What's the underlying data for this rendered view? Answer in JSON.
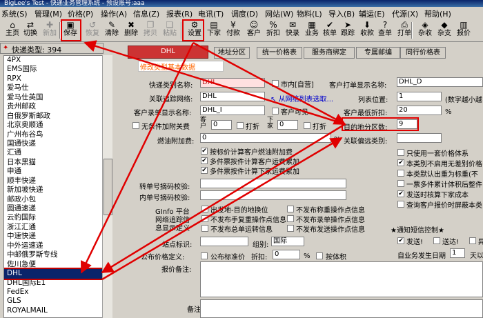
{
  "window": {
    "title": "BigLee's Test - 快递业务管理系统 - 预设账号:aaa"
  },
  "menu": [
    "系统(S)",
    "管理(M)",
    "价格(P)",
    "操作(A)",
    "信息(Z)",
    "报表(R)",
    "电讯(T)",
    "调度(D)",
    "网站(W)",
    "物料(L)",
    "导入(B)",
    "辅运(E)",
    "代源(X)",
    "帮助(H)"
  ],
  "toolbar": {
    "left": [
      {
        "icon": "home-icon",
        "glyph": "⌂",
        "label": "主页",
        "enabled": true
      },
      {
        "icon": "switch-icon",
        "glyph": "⇄",
        "label": "切换",
        "enabled": true
      },
      {
        "icon": "add-icon",
        "glyph": "✚",
        "label": "新加",
        "enabled": false
      },
      {
        "icon": "save-icon",
        "glyph": "▣",
        "label": "保存",
        "enabled": true
      },
      {
        "icon": "recycle-icon",
        "glyph": "↺",
        "label": "恢复",
        "enabled": false
      },
      {
        "icon": "clear-icon",
        "glyph": "✎",
        "label": "清除",
        "enabled": true
      },
      {
        "icon": "delete-icon",
        "glyph": "✖",
        "label": "删除",
        "enabled": true
      },
      {
        "icon": "copy-icon",
        "glyph": "❐",
        "label": "拷贝",
        "enabled": false
      },
      {
        "icon": "paste-icon",
        "glyph": "❏",
        "label": "粘贴",
        "enabled": false
      },
      {
        "icon": "settings-icon",
        "glyph": "⚙",
        "label": "设置",
        "enabled": true
      },
      {
        "icon": "order-icon",
        "glyph": "▤",
        "label": "下家",
        "enabled": true
      },
      {
        "icon": "pay-icon",
        "glyph": "¥",
        "label": "付款",
        "enabled": true
      },
      {
        "icon": "customer-icon",
        "glyph": "☺",
        "label": "客户",
        "enabled": true
      },
      {
        "icon": "discount-icon",
        "glyph": "%",
        "label": "折扣",
        "enabled": true
      },
      {
        "icon": "quick-icon",
        "glyph": "✉",
        "label": "快录",
        "enabled": true
      },
      {
        "icon": "business-icon",
        "glyph": "▦",
        "label": "业务",
        "enabled": true
      },
      {
        "icon": "check-icon",
        "glyph": "✔",
        "label": "核单",
        "enabled": true
      },
      {
        "icon": "track-icon",
        "glyph": "➤",
        "label": "跟踪",
        "enabled": true
      },
      {
        "icon": "receive-icon",
        "glyph": "⬇",
        "label": "收款",
        "enabled": true
      },
      {
        "icon": "query-icon",
        "glyph": "?",
        "label": "查单",
        "enabled": true
      },
      {
        "icon": "print-icon",
        "glyph": "⎙",
        "label": "打单",
        "enabled": true
      },
      {
        "icon": "misc-icon",
        "glyph": "◈",
        "label": "杂收",
        "enabled": true
      },
      {
        "icon": "misc-pay-icon",
        "glyph": "◆",
        "label": "杂支",
        "enabled": true
      },
      {
        "icon": "report-icon",
        "glyph": "▥",
        "label": "报价",
        "enabled": true
      }
    ]
  },
  "left_panel": {
    "header": "快递类型: 394",
    "items": [
      "4PX",
      "EMS国际",
      "RPX",
      "爱马仕",
      "爱马仕英国",
      "贵州邮政",
      "白俄罗斯邮政",
      "北京奥顺通",
      "广州布谷鸟",
      "国通快递",
      "汇通",
      "日本黑猫",
      "申通",
      "顺丰快递",
      "新加坡快递",
      "邮政小包",
      "圆通速递",
      "云豹国际",
      "浙江汇通",
      "中速快递",
      "中外运速递",
      "中邮俄罗斯专线",
      "佐川急便",
      "DHL",
      "DHL国际E1",
      "FedEx",
      "GLS",
      "ROYALMAIL"
    ],
    "selected": "DHL"
  },
  "tabs": [
    "DHL",
    "地址分区",
    "统一价格表",
    "服务商绑定",
    "专属邮编",
    "同行价格表"
  ],
  "form": {
    "modify_link": "修改类型基本数据",
    "type_name_label": "快递类别名称:",
    "type_name": "DHL",
    "local_label": "市内[自营]",
    "print_name_label": "客户打单显示名称:",
    "print_name": "DHL_D",
    "tracking_label": "关联追踪网络:",
    "tracking": "DHL",
    "select_link": "从网络列表选取...",
    "list_pos_label": "列表位置:",
    "list_pos": "1",
    "list_pos_hint": "(数字越小越",
    "cust_display_label": "客户录单显示名称:",
    "cust_display": "DHL_I",
    "cust_visible_label": "客户可见",
    "min_discount_label": "客户最低折扣:",
    "min_discount": "20",
    "percent": "%",
    "unconditional_label": "无条件加附关费",
    "customer_short": "客户",
    "lower_short": "下家",
    "fee1": "0",
    "fee2": "0",
    "discount_label": "打折",
    "dest_zone_label": "目的地分区数:",
    "dest_zone": "9",
    "fuel_label": "燃油附加费:",
    "fuel_val": "0",
    "related_label": "关联偏远类别:",
    "fuel_opts": [
      "按标价计算客户燃油附加费",
      "多件票按件计算客户运费累加",
      "多件票按件计算下家运费累加"
    ],
    "right_opts": [
      {
        "label": "只使用一套价格体系",
        "checked": false
      },
      {
        "label": "本类别不启用无差别价格",
        "checked": true
      },
      {
        "label": "本类默认出重为标重(不",
        "checked": false
      },
      {
        "label": "一票多件累计体积后整件",
        "checked": false
      },
      {
        "label": "发送时核算下家成本",
        "checked": true
      },
      {
        "label": "查询客户报价时屏蔽本类",
        "checked": false
      }
    ],
    "sms_title": "★通知短信控制★",
    "sms_send": "发送!",
    "sms_arrive": "送达!",
    "sms_third": "异",
    "biz_date_label": "自业务发生日期",
    "biz_date": "1",
    "days_label": "天以",
    "transfer_label": "转单号摘码校验:",
    "inner_label": "内单号摘码校验:",
    "ginfo_label": "GInfo 平台",
    "net_track_label": "网络追踪信",
    "custom_label": "息显示定义",
    "ginfo_opts": [
      "出发地-目的地换位",
      "不发布手复重操作点信息",
      "不发布总单运转信息"
    ],
    "ginfo_right_opts": [
      "不发布称重操作点信息",
      "不发布录单操作点信息",
      "不发布发送操作点信息"
    ],
    "station_label": "站点标识:",
    "group_label": "组别:",
    "group_val": "国际",
    "formula_label": "公布价格定义:",
    "publish_label": "公布标准价",
    "formula_discount_label": "折扣:",
    "formula_discount": "0",
    "by_volume_label": "按体积",
    "notes_label": "报价备注:",
    "remark_label": "备注"
  }
}
